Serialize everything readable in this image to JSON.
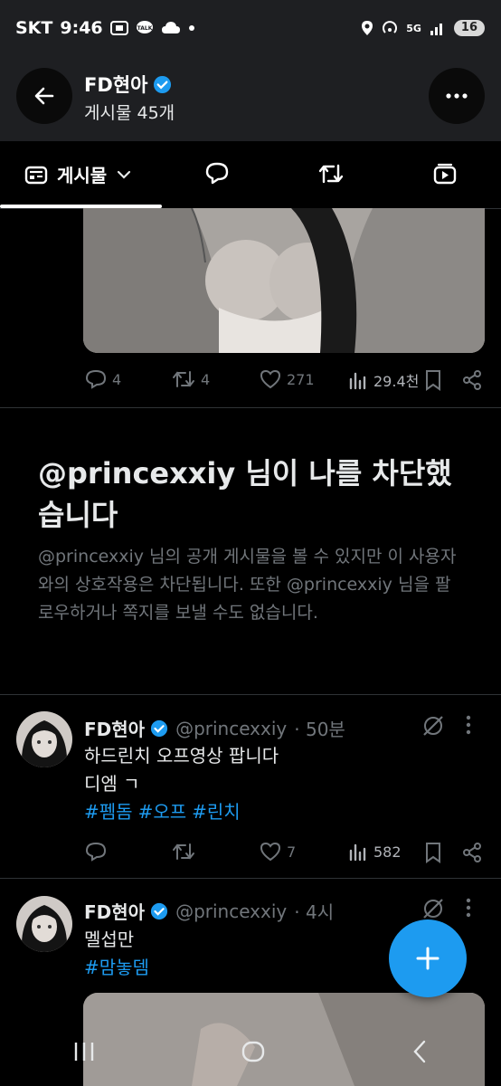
{
  "status_bar": {
    "carrier": "SKT",
    "time": "9:46",
    "battery": "16",
    "network": "5G"
  },
  "header": {
    "name": "FD현아",
    "post_count": "게시물 45개"
  },
  "tabs": {
    "posts_label": "게시물"
  },
  "tweet_top": {
    "replies": "4",
    "retweets": "4",
    "likes": "271",
    "views": "29.4천"
  },
  "blocked": {
    "title": "@princexxiy 님이 나를 차단했습니다",
    "description": "@princexxiy 님의 공개 게시물을 볼 수 있지만 이 사용자와의 상호작용은 차단됩니다. 또한 @princexxiy 님을 팔로우하거나 쪽지를 보낼 수도 없습니다."
  },
  "tweets": [
    {
      "name": "FD현아",
      "handle": "@princexxiy",
      "time": "· 50분",
      "line1": "하드린치 오프영상 팝니다",
      "line2": "디엠 ㄱ",
      "hashtags": [
        "#펨돔",
        "#오프",
        "#린치"
      ],
      "replies": "",
      "retweets": "",
      "likes": "7",
      "views": "582"
    },
    {
      "name": "FD현아",
      "handle": "@princexxiy",
      "time": "· 4시",
      "line1": "멜섭만",
      "hashtags": [
        "#맘놓뎀"
      ]
    }
  ],
  "colors": {
    "accent": "#1d9bf0",
    "background": "#000000",
    "header": "#1e1f22"
  }
}
